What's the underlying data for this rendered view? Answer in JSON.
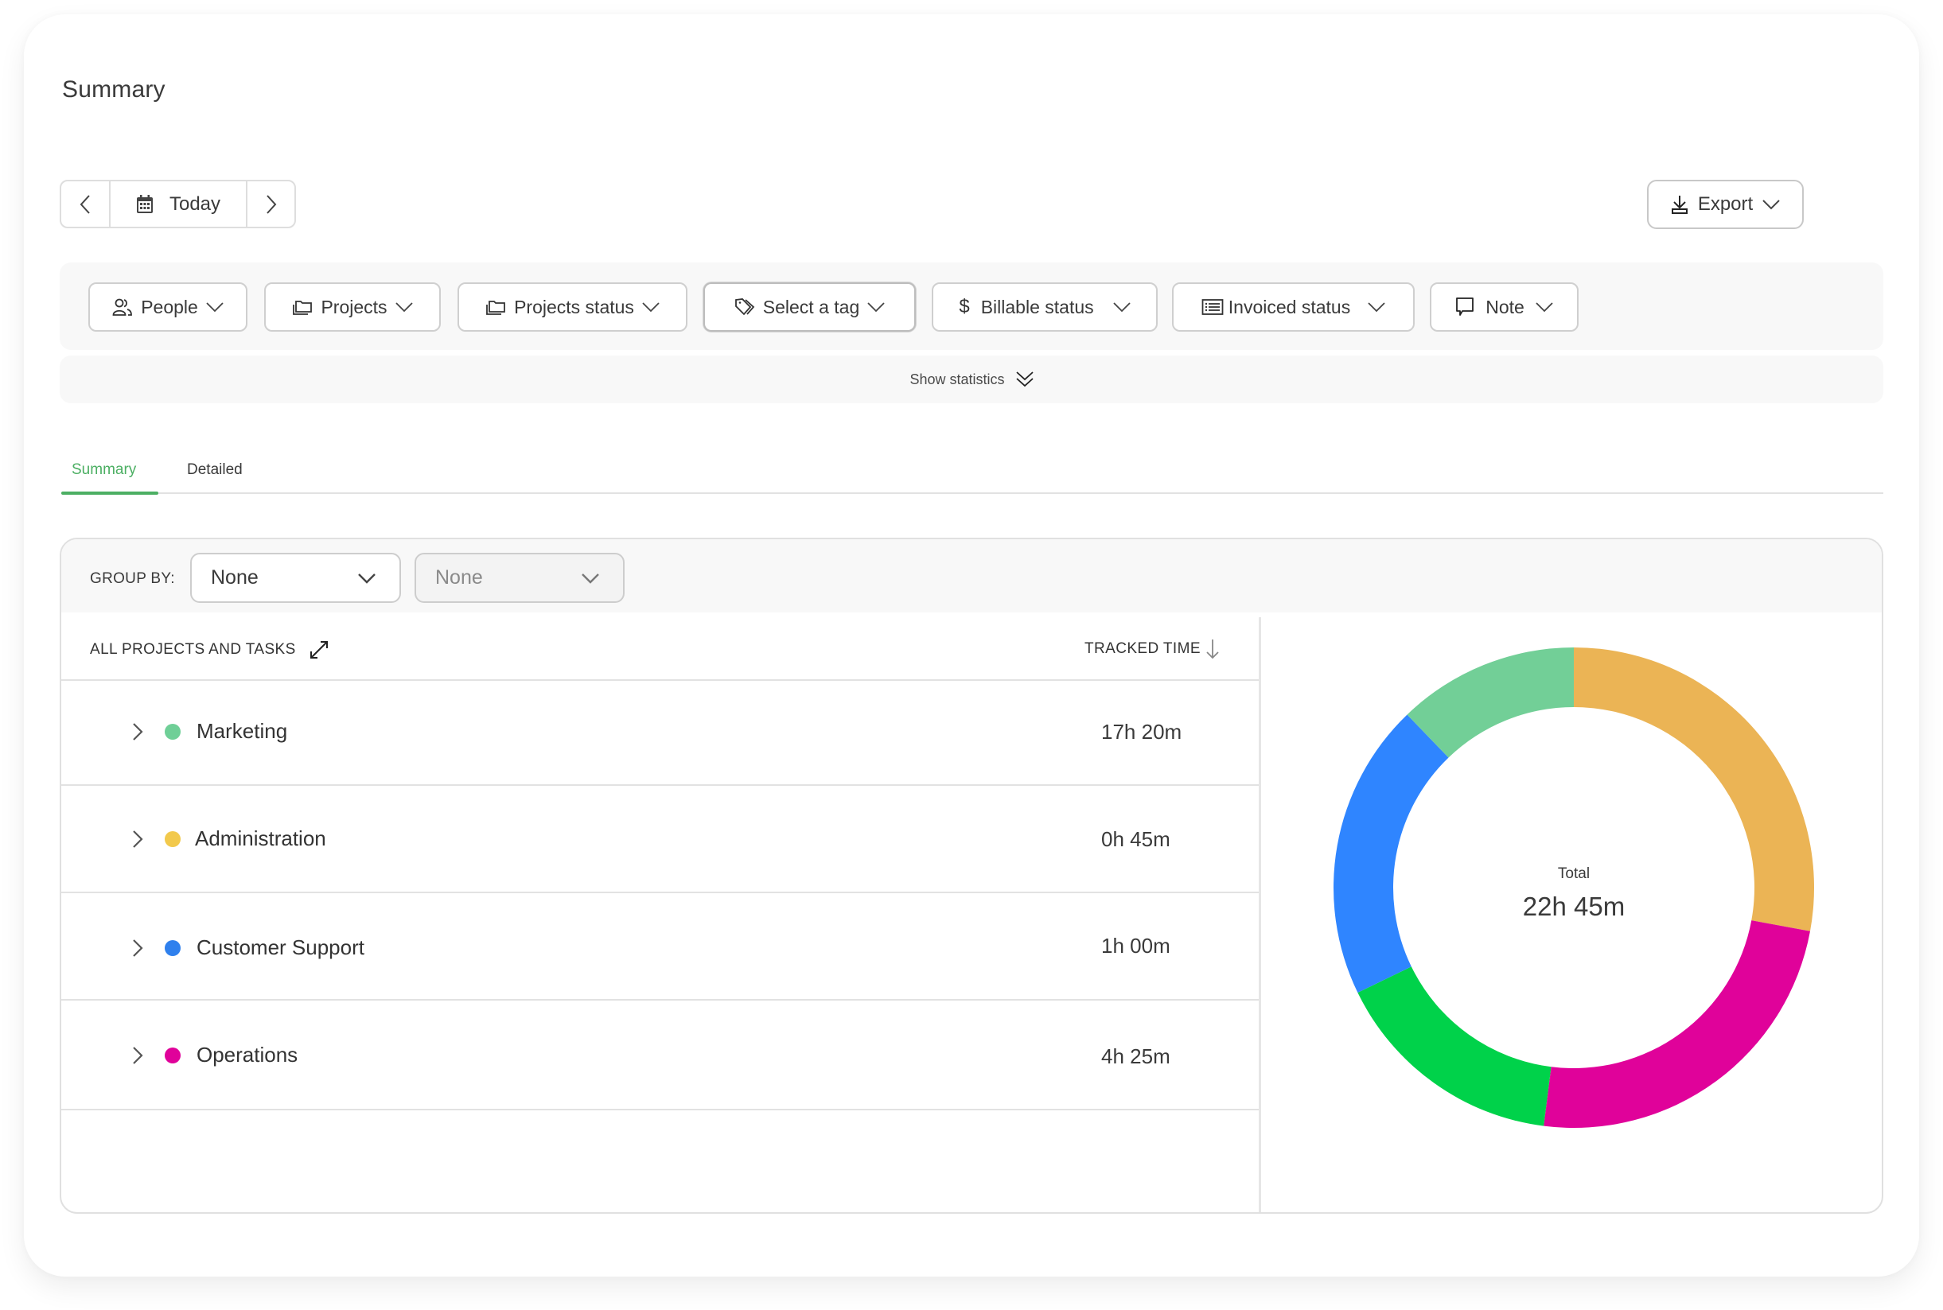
{
  "page": {
    "title": "Summary"
  },
  "date_nav": {
    "prev_icon": "chevron-left-icon",
    "calendar_icon": "calendar-icon",
    "label": "Today",
    "next_icon": "chevron-right-icon"
  },
  "export": {
    "icon": "download-icon",
    "label": "Export",
    "chevron": "chevron-down-icon"
  },
  "filters": [
    {
      "label": "People",
      "icon": "people-icon"
    },
    {
      "label": "Projects",
      "icon": "folder-icon"
    },
    {
      "label": "Projects status",
      "icon": "folder-icon"
    },
    {
      "label": "Select a tag",
      "icon": "tag-icon"
    },
    {
      "label": "Billable status",
      "icon": "dollar-icon"
    },
    {
      "label": "Invoiced status",
      "icon": "invoice-list-icon"
    },
    {
      "label": "Note",
      "icon": "comment-icon"
    }
  ],
  "statistics_toggle": {
    "label": "Show statistics",
    "icon": "double-chevron-down-icon"
  },
  "tabs": [
    {
      "label": "Summary",
      "active": true
    },
    {
      "label": "Detailed",
      "active": false
    }
  ],
  "group_by": {
    "label": "GROUP BY:",
    "primary": {
      "value": "None",
      "enabled": true
    },
    "secondary": {
      "value": "None",
      "enabled": false
    }
  },
  "table": {
    "headers": {
      "name": "ALL PROJECTS AND TASKS",
      "name_icon": "expand-icon",
      "time": "TRACKED TIME",
      "time_icon": "sort-descending-icon"
    },
    "rows": [
      {
        "name": "Marketing",
        "color": "#6fcf97",
        "time": "17h 20m"
      },
      {
        "name": "Administration",
        "color": "#f2c94c",
        "time": "0h 45m"
      },
      {
        "name": "Customer Support",
        "color": "#2f80ed",
        "time": "1h 00m"
      },
      {
        "name": "Operations",
        "color": "#e0029a",
        "time": "4h 25m"
      }
    ]
  },
  "chart_data": {
    "type": "pie",
    "variant": "donut",
    "title": "",
    "center_label": "Total",
    "center_value": "22h 45m",
    "start": "top",
    "direction": "clockwise",
    "slices": [
      {
        "color": "#ebb455",
        "fraction": 0.279
      },
      {
        "color": "#e0029a",
        "fraction": 0.241
      },
      {
        "color": "#00d24a",
        "fraction": 0.158
      },
      {
        "color": "#2f85ff",
        "fraction": 0.2
      },
      {
        "color": "#72cf97",
        "fraction": 0.122
      }
    ],
    "legend": "none"
  },
  "colors": {
    "accent": "#4caf63",
    "border": "#dedede",
    "panel_bg": "#f8f8f8"
  }
}
